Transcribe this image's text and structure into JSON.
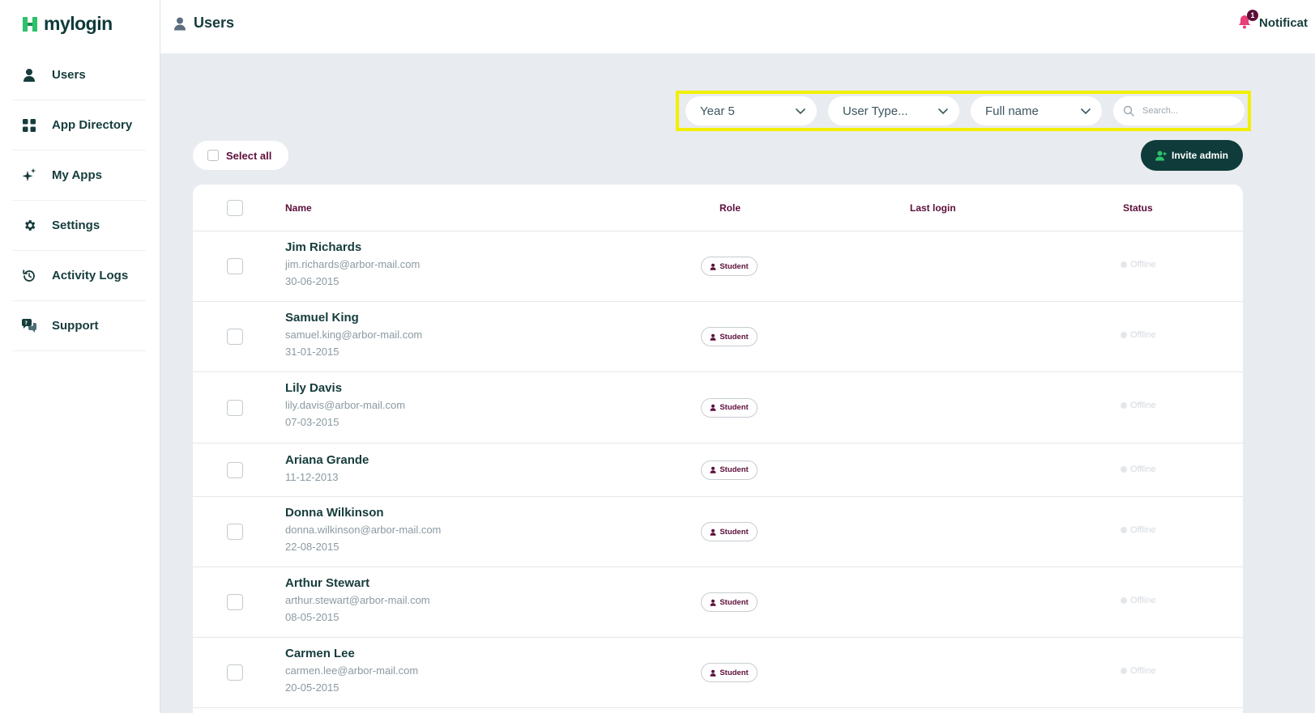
{
  "app": {
    "logo_text": "mylogin",
    "brand_color": "#2ec26b",
    "accent": "#0f3b3a",
    "secondary": "#5c0f3a"
  },
  "sidebar": {
    "items": [
      {
        "label": "Users",
        "icon": "user-icon"
      },
      {
        "label": "App Directory",
        "icon": "grid-icon"
      },
      {
        "label": "My Apps",
        "icon": "sparkle-icon"
      },
      {
        "label": "Settings",
        "icon": "gear-icon"
      },
      {
        "label": "Activity Logs",
        "icon": "history-icon"
      },
      {
        "label": "Support",
        "icon": "chat-icon"
      }
    ]
  },
  "header": {
    "title": "Users",
    "notifications_label": "Notificat",
    "notifications_count": "1"
  },
  "filters": {
    "year": "Year 5",
    "user_type": "User Type...",
    "sort": "Full name",
    "search_placeholder": "Search..."
  },
  "actions": {
    "select_all": "Select all",
    "invite_admin": "Invite admin"
  },
  "table": {
    "columns": {
      "name": "Name",
      "role": "Role",
      "last_login": "Last login",
      "status": "Status"
    },
    "rows": [
      {
        "name": "Jim Richards",
        "email": "jim.richards@arbor-mail.com",
        "dob": "30-06-2015",
        "role": "Student",
        "status": "Offline"
      },
      {
        "name": "Samuel King",
        "email": "samuel.king@arbor-mail.com",
        "dob": "31-01-2015",
        "role": "Student",
        "status": "Offline"
      },
      {
        "name": "Lily Davis",
        "email": "lily.davis@arbor-mail.com",
        "dob": "07-03-2015",
        "role": "Student",
        "status": "Offline"
      },
      {
        "name": "Ariana Grande",
        "email": "",
        "dob": "11-12-2013",
        "role": "Student",
        "status": "Offline"
      },
      {
        "name": "Donna Wilkinson",
        "email": "donna.wilkinson@arbor-mail.com",
        "dob": "22-08-2015",
        "role": "Student",
        "status": "Offline"
      },
      {
        "name": "Arthur Stewart",
        "email": "arthur.stewart@arbor-mail.com",
        "dob": "08-05-2015",
        "role": "Student",
        "status": "Offline"
      },
      {
        "name": "Carmen Lee",
        "email": "carmen.lee@arbor-mail.com",
        "dob": "20-05-2015",
        "role": "Student",
        "status": "Offline"
      }
    ]
  }
}
